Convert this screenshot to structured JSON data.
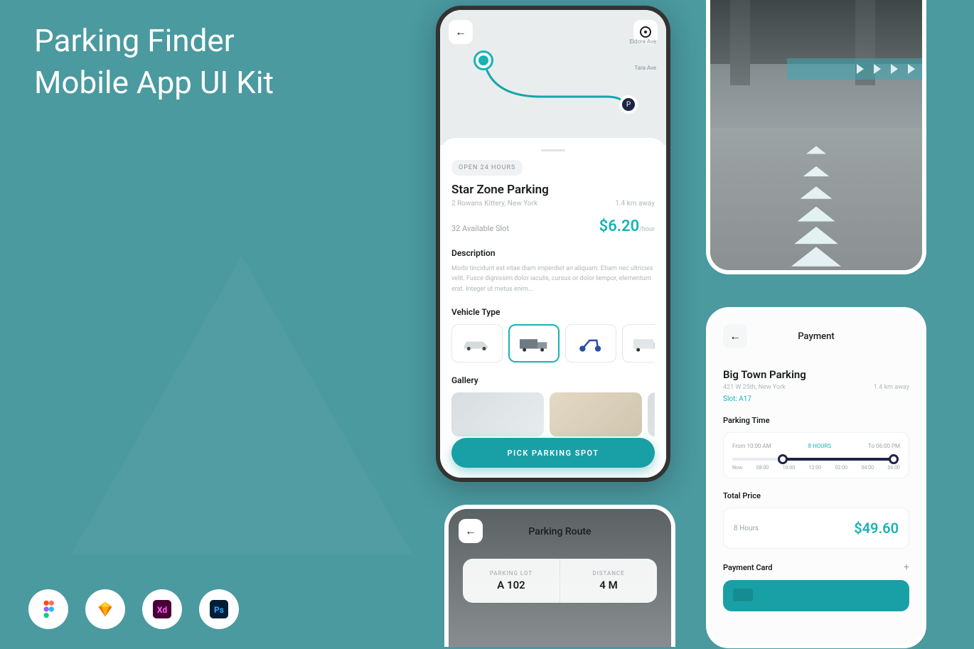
{
  "hero": {
    "line1": "Parking Finder",
    "line2": "Mobile App UI Kit"
  },
  "tools": [
    "figma",
    "sketch",
    "xd",
    "photoshop"
  ],
  "main": {
    "badge": "OPEN 24 HOURS",
    "title": "Star Zone Parking",
    "address": "2 Rowans Kittery, New York",
    "distance": "1.4 km away",
    "availability": "32 Available Slot",
    "price": "$6.20",
    "price_unit": "/hour",
    "desc_heading": "Description",
    "desc_text": "Morbi tincidunt est vitae diam imperdiet an aliquam. Etiam nec ultricies velit. Fusce dignissim dolor iaculis, cursus or dolor tempor, elementum erat. Integer ut metus enim...",
    "vehicle_heading": "Vehicle Type",
    "gallery_heading": "Gallery",
    "cta": "PICK PARKING SPOT",
    "map_street_1": "Eldora Ave",
    "map_street_2": "Tara Ave"
  },
  "route": {
    "title": "Parking Route",
    "stat1_label": "PARKING LOT",
    "stat1_value": "A 102",
    "stat2_label": "DISTANCE",
    "stat2_value": "4 M"
  },
  "payment": {
    "title": "Payment",
    "name": "Big Town Parking",
    "address": "421 W 25th, New York",
    "distance": "1.4 km away",
    "slot": "Slot: A17",
    "time_heading": "Parking Time",
    "from": "From 10:00 AM",
    "duration": "8 HOURS",
    "to": "To 06:00 PM",
    "ticks": [
      "Now",
      "08:00",
      "10:00",
      "12:00",
      "02:00",
      "04:00",
      "06:00"
    ],
    "total_heading": "Total Price",
    "total_label": "8 Hours",
    "total_value": "$49.60",
    "card_heading": "Payment Card"
  }
}
